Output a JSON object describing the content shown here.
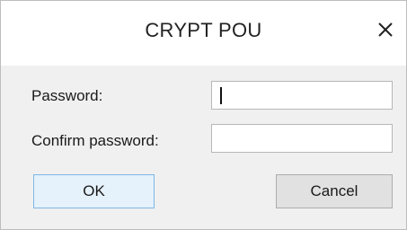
{
  "dialog": {
    "title": "CRYPT POU",
    "close_icon": "close-icon"
  },
  "form": {
    "password_label": "Password:",
    "password_value": "",
    "confirm_label": "Confirm password:",
    "confirm_value": ""
  },
  "buttons": {
    "ok_label": "OK",
    "cancel_label": "Cancel"
  },
  "colors": {
    "ok_button_bg": "#e5f1fb",
    "ok_button_border": "#7fb7e6",
    "dialog_bg": "#f0f0f0"
  }
}
